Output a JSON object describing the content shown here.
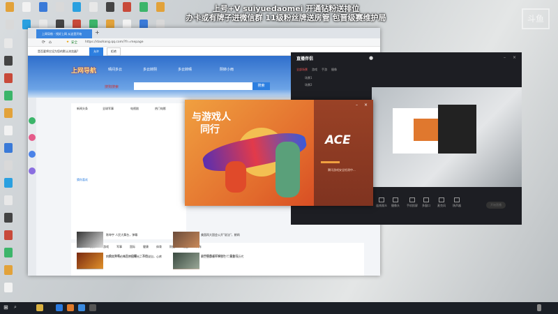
{
  "overlay": {
    "line1": "上号+V suiyuedaomei  开通钻粉送排位",
    "line2": "办卡或有牌子进微信群 11级粉丝牌送房管  包晋级赛维护局"
  },
  "browser": {
    "tab_title": "上网导航 - 找好上网 从这里开始",
    "new_tab": "+",
    "url_prefix": "安全",
    "url": "https://daohang.qq.com/?fr=mepage",
    "notification": "是否要将它设为您的默认浏览器?",
    "allow": "允许",
    "deny": "拒绝",
    "logo_text": "上网导航",
    "search_engine": "搜狗搜索",
    "search_button": "搜索",
    "weather": [
      "晴间多云",
      "多云转阴",
      "多云转晴",
      "阴转小雨"
    ],
    "quick_links": [
      "新闻头条",
      "全球军事",
      "电视剧",
      "热门电影"
    ],
    "section_title": "猜你喜欢",
    "news_tabs": [
      "热点",
      "娱乐",
      "游戏",
      "军事",
      "国际",
      "健康",
      "体育",
      "财经",
      "社会",
      "汽车"
    ],
    "news": [
      "妈妈离开马伯骞后原因曝光，不用说自，心疼",
      "前卫生部长不幸去世？ 需要与历代",
      "陈坤宇 人民大舞台，弹幕",
      "美国再大国会公开\"说法\"，朗闻",
      "一些一年都，一万一亿得，三万亿",
      "当中国首战打如何？ 三巨头打"
    ]
  },
  "stream_app": {
    "title": "直播伴侣",
    "tabs": [
      "全部场景",
      "游戏",
      "手游",
      "摄像"
    ],
    "scenes": [
      "场景1",
      "场景2"
    ],
    "controls": [
      "连线观众",
      "摄像头",
      "手机投屏",
      "多窗口",
      "麦克风",
      "扬声器"
    ],
    "start_button": "开始直播"
  },
  "ace": {
    "slogan_line1": "与游戏人",
    "slogan_line2": "同行",
    "logo": "ACE",
    "status": "腾讯游戏安全检测中..."
  },
  "watermark": "斗鱼"
}
